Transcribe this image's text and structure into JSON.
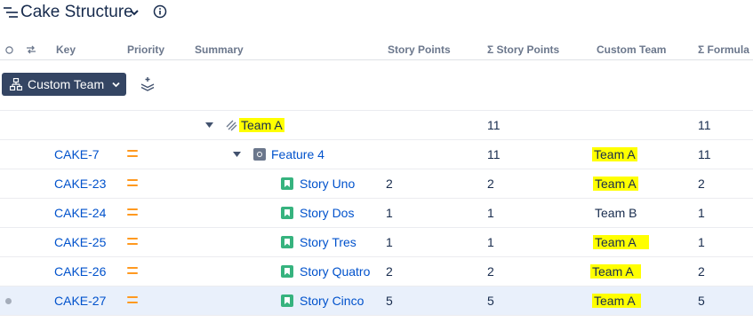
{
  "title": "Cake Structure",
  "columns": [
    "Key",
    "Priority",
    "Summary",
    "Story Points",
    "Σ Story Points",
    "Custom Team",
    "Σ Formula"
  ],
  "toolbar": {
    "group_button_label": "Custom Team"
  },
  "rows": [
    {
      "key": "",
      "summary": "Team A",
      "story_points": "",
      "sum_story_points": "11",
      "custom_team": "",
      "sum_formula": "11"
    },
    {
      "key": "CAKE-7",
      "summary": "Feature 4",
      "story_points": "",
      "sum_story_points": "11",
      "custom_team": "Team A",
      "sum_formula": "11"
    },
    {
      "key": "CAKE-23",
      "summary": "Story Uno",
      "story_points": "2",
      "sum_story_points": "2",
      "custom_team": "Team A",
      "sum_formula": "2"
    },
    {
      "key": "CAKE-24",
      "summary": "Story Dos",
      "story_points": "1",
      "sum_story_points": "1",
      "custom_team": "Team B",
      "sum_formula": "1"
    },
    {
      "key": "CAKE-25",
      "summary": "Story Tres",
      "story_points": "1",
      "sum_story_points": "1",
      "custom_team": "Team A",
      "sum_formula": "1"
    },
    {
      "key": "CAKE-26",
      "summary": "Story Quatro",
      "story_points": "2",
      "sum_story_points": "2",
      "custom_team": "Team A",
      "sum_formula": "2"
    },
    {
      "key": "CAKE-27",
      "summary": "Story Cinco",
      "story_points": "5",
      "sum_story_points": "5",
      "custom_team": "Team A",
      "sum_formula": "5"
    }
  ],
  "colors": {
    "highlight": "#ffff00",
    "link": "#0052cc",
    "priority": "#ff991f",
    "story_icon": "#36b37e",
    "selected_row": "#e9f0fb",
    "toolbar_button": "#344563"
  }
}
